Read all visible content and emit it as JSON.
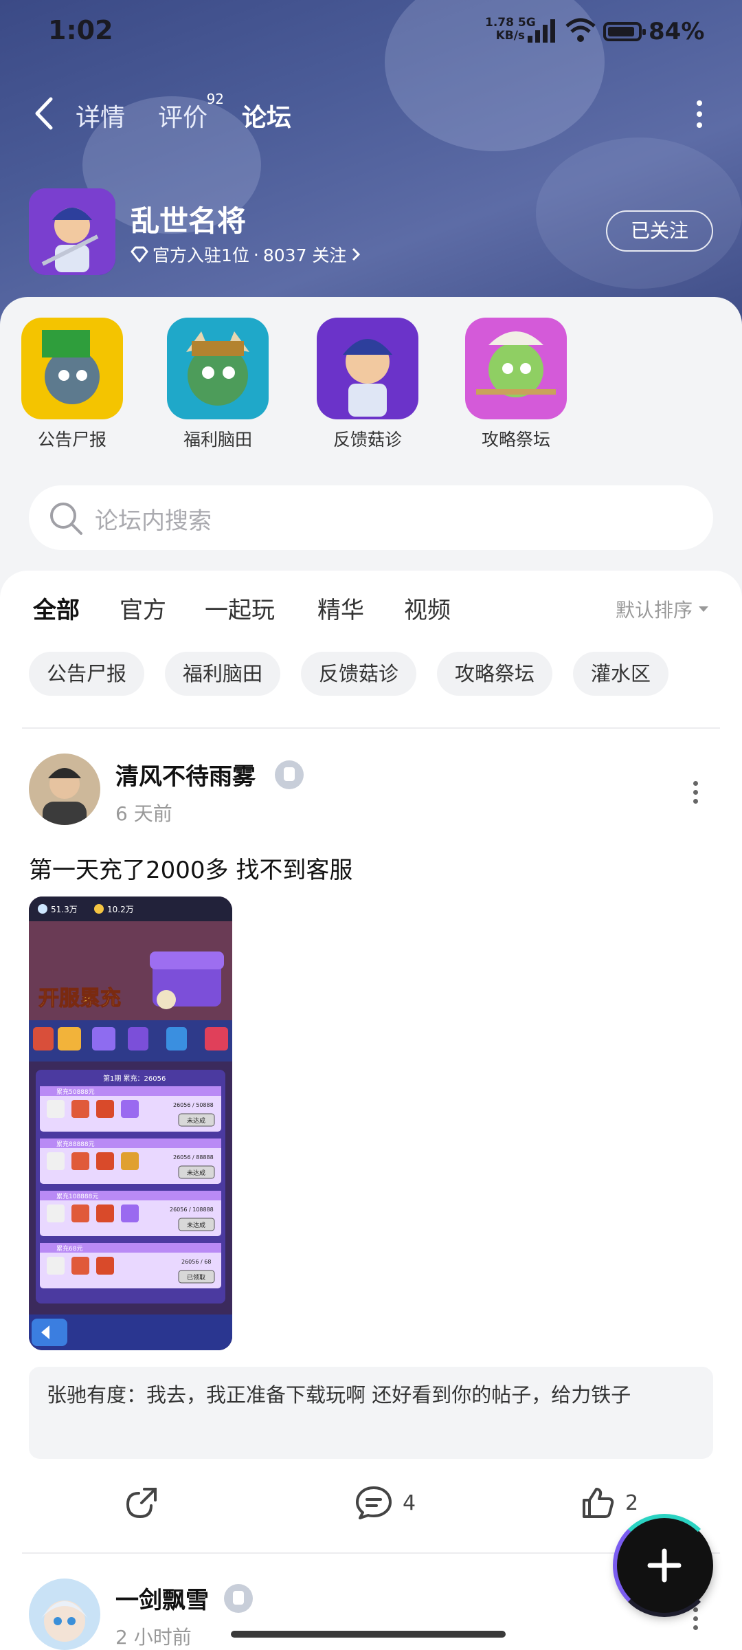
{
  "status_bar": {
    "time": "1:02",
    "net_speed": "1.78",
    "net_unit": "KB/s",
    "net_type": "5G",
    "battery": "84%"
  },
  "nav": {
    "back_icon": "chevron-left-icon",
    "tabs": [
      {
        "label": "详情"
      },
      {
        "label": "评价",
        "badge": "92"
      },
      {
        "label": "论坛"
      }
    ],
    "more_icon": "more-vertical-icon"
  },
  "game": {
    "title": "乱世名将",
    "official": "官方入驻1位",
    "separator": "·",
    "followers": "8037 关注",
    "follow_button": "已关注"
  },
  "categories": [
    {
      "label": "公告尸报"
    },
    {
      "label": "福利脑田"
    },
    {
      "label": "反馈菇诊"
    },
    {
      "label": "攻略祭坛"
    }
  ],
  "search": {
    "placeholder": "论坛内搜索"
  },
  "feed_tabs": [
    {
      "label": "全部"
    },
    {
      "label": "官方"
    },
    {
      "label": "一起玩"
    },
    {
      "label": "精华"
    },
    {
      "label": "视频"
    }
  ],
  "sort": {
    "label": "默认排序"
  },
  "chips": [
    {
      "label": "公告尸报"
    },
    {
      "label": "福利脑田"
    },
    {
      "label": "反馈菇诊"
    },
    {
      "label": "攻略祭坛"
    },
    {
      "label": "灌水区"
    }
  ],
  "posts": [
    {
      "user": "清风不待雨雾",
      "time": "6 天前",
      "text": "第一天充了2000多 找不到客服",
      "image": {
        "currency1": "51.3万",
        "currency2": "10.2万",
        "banner": "开服累充",
        "period": "第1期 累充：26056",
        "rows": [
          {
            "title": "累充50888元",
            "progress": "26056 / 50888",
            "status": "未达成"
          },
          {
            "title": "累充88888元",
            "progress": "26056 / 88888",
            "status": "未达成"
          },
          {
            "title": "累充108888元",
            "progress": "26056 / 108888",
            "status": "未达成"
          },
          {
            "title": "累充68元",
            "progress": "26056 / 68",
            "status": "已领取"
          }
        ]
      },
      "comment": "张驰有度：我去，我正准备下载玩啊 还好看到你的帖子，给力铁子",
      "comments_count": "4",
      "likes_count": "2"
    },
    {
      "user": "一剑飘雪",
      "time": "2 小时前"
    }
  ],
  "colors": {
    "accent": "#25d5c7",
    "header": "#4b5c98"
  }
}
